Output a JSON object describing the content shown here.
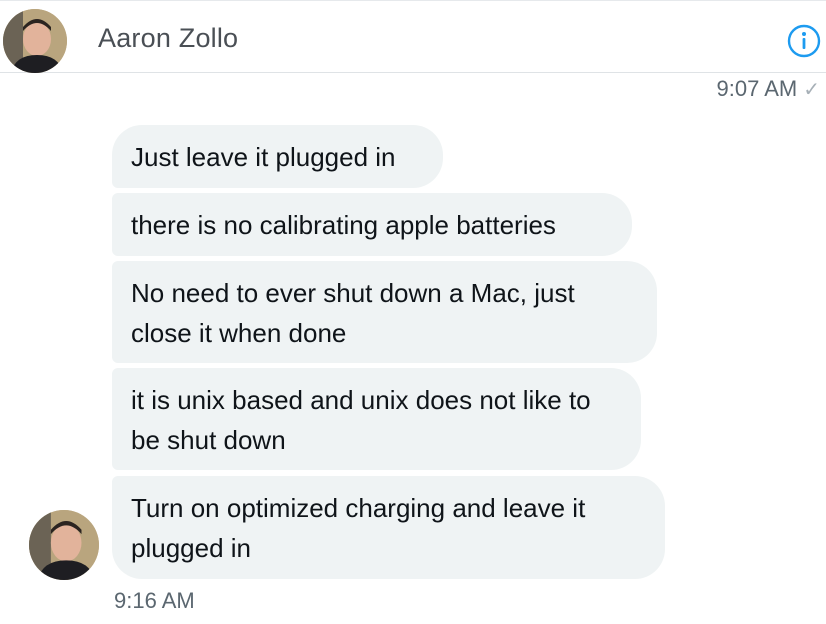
{
  "header": {
    "name": "Aaron Zollo",
    "avatar_icon": "user-avatar",
    "info_icon": "info-icon",
    "accent": "#1d9bf0"
  },
  "thread": {
    "read_time": "9:07 AM",
    "read_indicator_icon": "checkmark-icon",
    "messages": [
      {
        "text": "Just leave it plugged in"
      },
      {
        "text": "there is no calibrating apple batteries"
      },
      {
        "text": "No need to ever shut down a Mac, just close it when done"
      },
      {
        "text": "it is unix based and unix does not like to be shut down"
      },
      {
        "text": "Turn on optimized charging and leave it plugged in"
      }
    ],
    "sent_time": "9:16 AM",
    "bubble_color": "#eff3f4"
  }
}
